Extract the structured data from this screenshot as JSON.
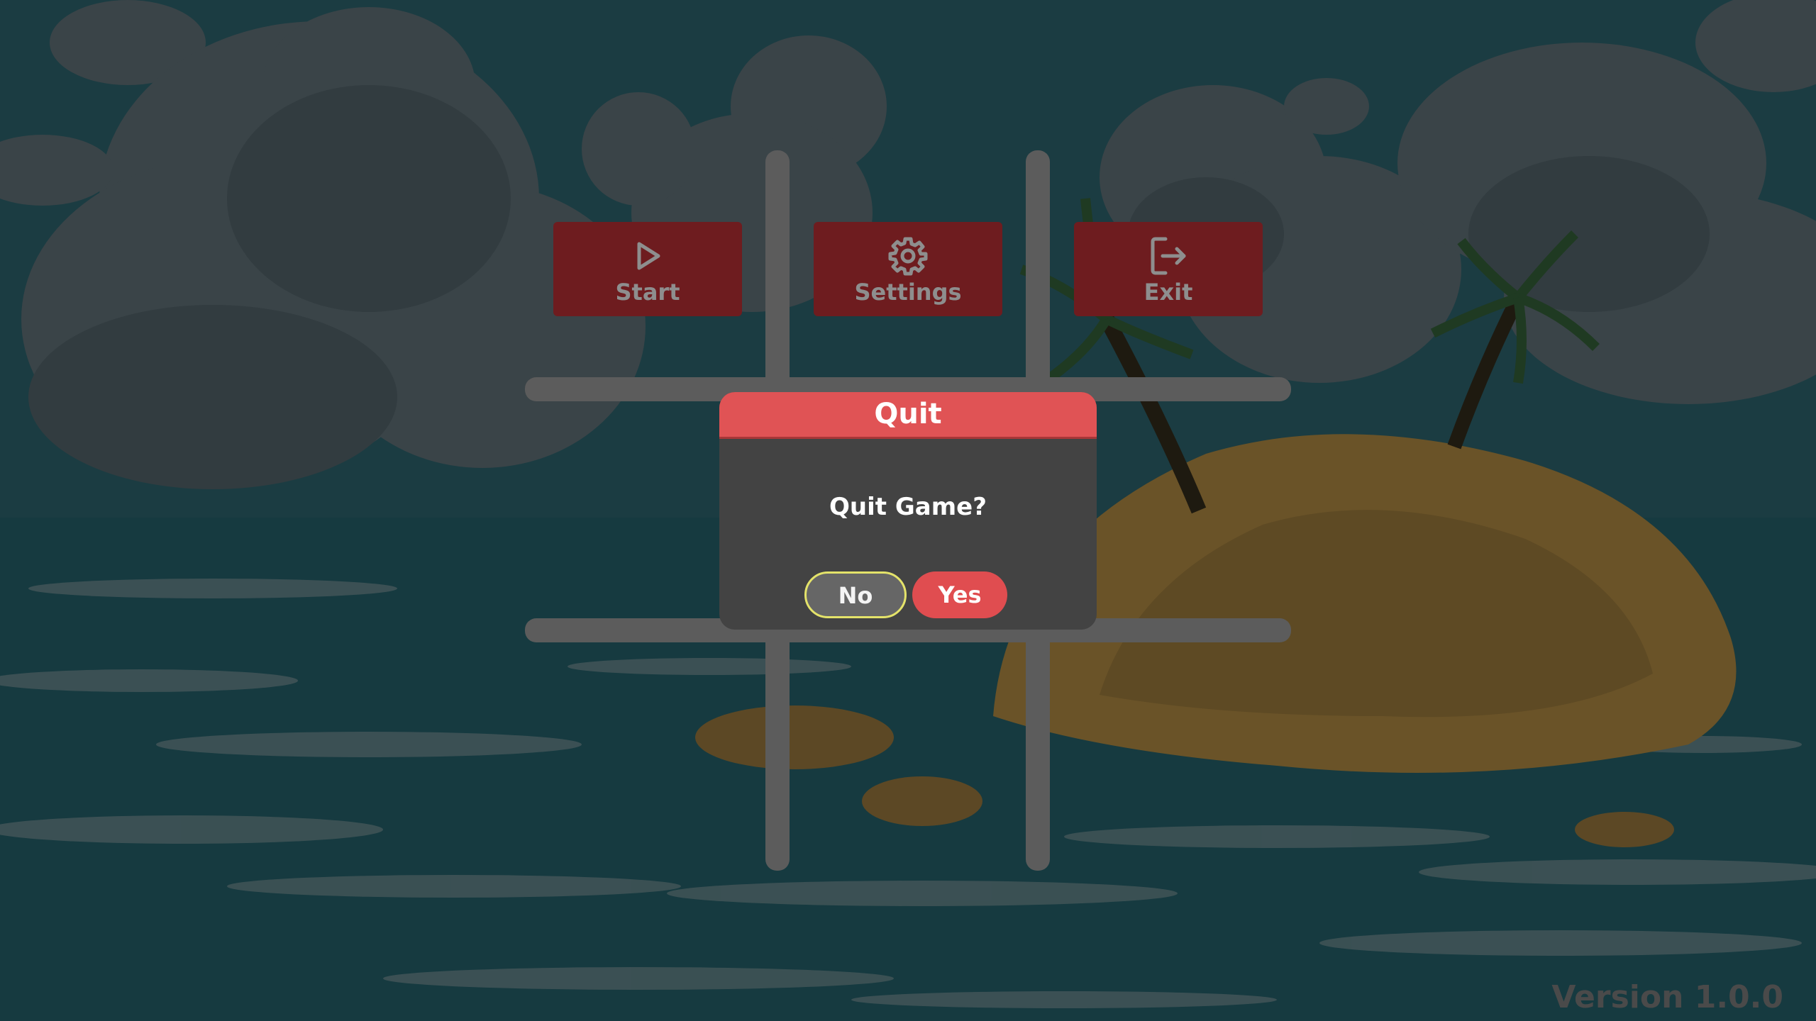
{
  "menu": {
    "start": {
      "label": "Start",
      "icon": "play-icon"
    },
    "settings": {
      "label": "Settings",
      "icon": "gear-icon"
    },
    "exit": {
      "label": "Exit",
      "icon": "exit-icon"
    }
  },
  "dialog": {
    "title": "Quit",
    "message": "Quit Game?",
    "no_label": "No",
    "yes_label": "Yes",
    "selected": "No"
  },
  "footer": {
    "version": "Version 1.0.0"
  },
  "colors": {
    "accent_red": "#e05355",
    "menu_button_bg": "#6e1c1f",
    "dialog_bg": "#434343",
    "focus_outline": "#e4e36a",
    "grid_line": "#5c5c5c"
  }
}
